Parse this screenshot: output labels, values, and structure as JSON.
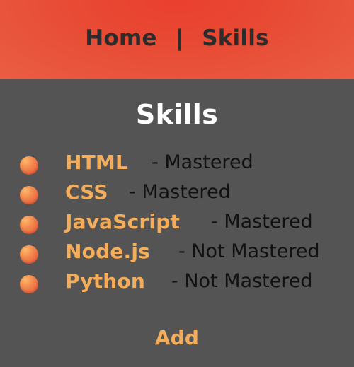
{
  "nav": {
    "home_label": "Home",
    "separator": "|",
    "skills_label": "Skills"
  },
  "main": {
    "title": "Skills",
    "skills": [
      {
        "name": "HTML",
        "status": "- Mastered"
      },
      {
        "name": "CSS",
        "status": "- Mastered"
      },
      {
        "name": "JavaScript",
        "status": "- Mastered"
      },
      {
        "name": "Node.js",
        "status": "- Not Mastered"
      },
      {
        "name": "Python",
        "status": "- Not Mastered"
      }
    ],
    "add_label": "Add"
  },
  "colors": {
    "nav_bg": "#e84a34",
    "page_bg": "#545454",
    "accent_orange": "#f4ad5a",
    "title_white": "#ffffff",
    "nav_text": "#2c2c2c",
    "status_text": "#111111"
  }
}
